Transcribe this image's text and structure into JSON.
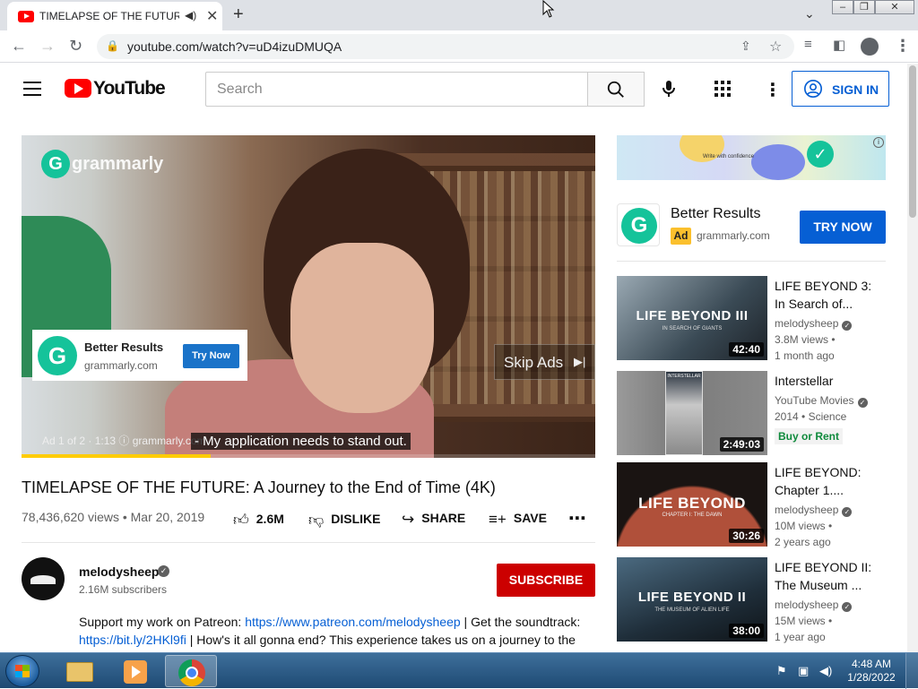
{
  "browser": {
    "tab_title": "TIMELAPSE OF THE FUTURE: A Journey to the End of Time (4K)",
    "url": "youtube.com/watch?v=uD4izuDMUQA"
  },
  "yt_header": {
    "logo_text": "YouTube",
    "search_placeholder": "Search",
    "signin_label": "SIGN IN"
  },
  "player": {
    "brand_text": "grammarly",
    "ad_card": {
      "title": "Better Results",
      "domain": "grammarly.com",
      "button": "Try Now"
    },
    "skip_label": "Skip Ads",
    "ad_info": "Ad 1 of 2 · 1:13  ⓘ  grammarly.com",
    "caption": "- My application needs to stand out.",
    "ad_progress": 0.33
  },
  "video": {
    "title": "TIMELAPSE OF THE FUTURE: A Journey to the End of Time (4K)",
    "meta": "78,436,620 views • Mar 20, 2019",
    "likes": "2.6M",
    "dislike_label": "DISLIKE",
    "share_label": "SHARE",
    "save_label": "SAVE"
  },
  "channel": {
    "name": "melodysheep",
    "subscribers": "2.16M subscribers",
    "subscribe_label": "SUBSCRIBE"
  },
  "description": {
    "line1_text": "Support my work on Patreon: ",
    "line1_link": "https://www.patreon.com/melodysheep",
    "line1_rest": "  |  Get the soundtrack:",
    "line2_link": "https://bit.ly/2HKl9fi",
    "line2_rest": "  |   How's it all gonna end?  This experience takes us on a journey to the"
  },
  "sidebar_ad": {
    "banner_text": "Write with confidence",
    "title": "Better Results",
    "badge": "Ad",
    "domain": "grammarly.com",
    "button": "TRY NOW"
  },
  "recommendations": [
    {
      "thumb_text": "LIFE BEYOND III",
      "thumb_sub": "IN SEARCH OF GIANTS",
      "duration": "42:40",
      "title_line1": "LIFE BEYOND 3:",
      "title_line2": "In Search of...",
      "channel": "melodysheep",
      "meta1": "3.8M views •",
      "meta2": "1 month ago"
    },
    {
      "thumb_text": "INTERSTELLAR",
      "duration": "2:49:03",
      "title_line1": "Interstellar",
      "channel": "YouTube Movies",
      "meta1": "2014 • Science",
      "buy_label": "Buy or Rent"
    },
    {
      "thumb_text": "LIFE BEYOND",
      "thumb_sub": "CHAPTER I: THE DAWN",
      "duration": "30:26",
      "title_line1": "LIFE BEYOND:",
      "title_line2": "Chapter 1....",
      "channel": "melodysheep",
      "meta1": "10M views •",
      "meta2": "2 years ago"
    },
    {
      "thumb_text": "LIFE BEYOND II",
      "thumb_sub": "THE MUSEUM OF ALIEN LIFE",
      "duration": "38:00",
      "title_line1": "LIFE BEYOND II:",
      "title_line2": "The Museum ...",
      "channel": "melodysheep",
      "meta1": "15M views •",
      "meta2": "1 year ago"
    }
  ],
  "taskbar": {
    "time": "4:48 AM",
    "date": "1/28/2022"
  },
  "colors": {
    "youtube_red": "#ff0000",
    "subscribe_red": "#cc0000",
    "link_blue": "#065fd4",
    "grammarly_green": "#15c39a",
    "ad_badge_yellow": "#fbc02d"
  }
}
